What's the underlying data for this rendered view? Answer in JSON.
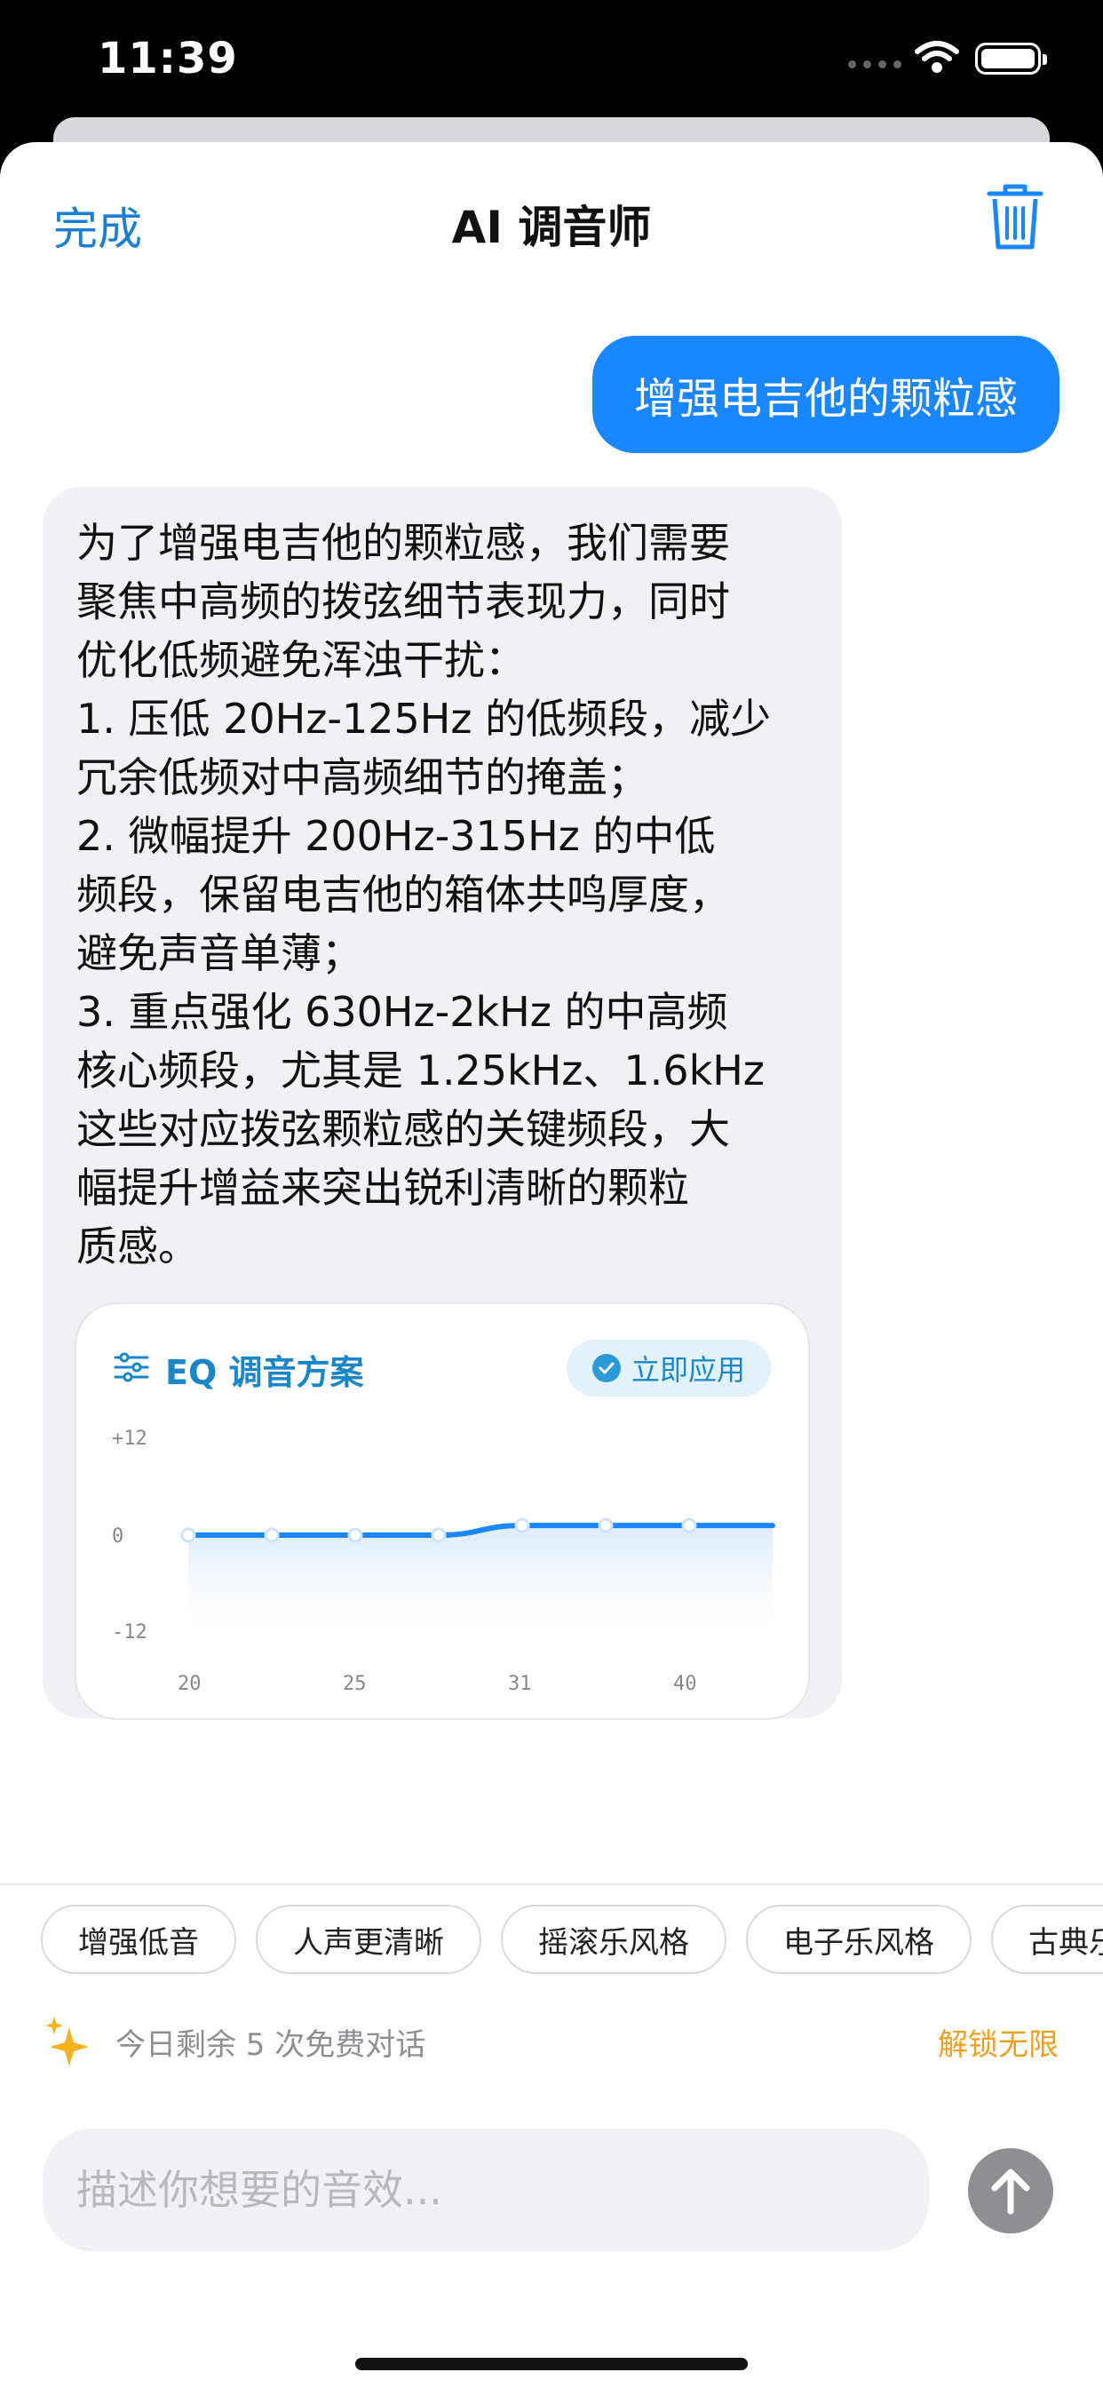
{
  "status_bar": {
    "time": "11:39"
  },
  "nav": {
    "done_label": "完成",
    "title": "AI 调音师",
    "trash_icon": "trash-icon"
  },
  "chat": {
    "user_message": "增强电吉他的颗粒感",
    "ai_message": "为了增强电吉他的颗粒感，我们需要\n聚焦中高频的拨弦细节表现力，同时\n优化低频避免浑浊干扰：\n1. 压低 20Hz-125Hz 的低频段，减少\n冗余低频对中高频细节的掩盖；\n2. 微幅提升 200Hz-315Hz 的中低\n频段，保留电吉他的箱体共鸣厚度，\n避免声音单薄；\n3. 重点强化 630Hz-2kHz 的中高频\n核心频段，尤其是 1.25kHz、1.6kHz\n这些对应拨弦颗粒感的关键频段，大\n幅提升增益来突出锐利清晰的颗粒\n质感。"
  },
  "eq_card": {
    "title": "EQ 调音方案",
    "apply_label": "立即应用",
    "accent_color": "#1a86c8"
  },
  "chart_data": {
    "type": "line",
    "y_tick_labels": [
      "+12",
      "0",
      "-12"
    ],
    "ylim": [
      -12,
      12
    ],
    "x_tick_labels": [
      "20",
      "25",
      "31",
      "40"
    ],
    "x_tick_positions": [
      0,
      2,
      4,
      6
    ],
    "series": [
      {
        "values": [
          0,
          0,
          0,
          0,
          1,
          1,
          1,
          1
        ]
      }
    ],
    "line_color": "#1a86ff"
  },
  "suggestions": [
    "增强低音",
    "人声更清晰",
    "摇滚乐风格",
    "电子乐风格",
    "古典乐风格"
  ],
  "quota": {
    "remaining_text": "今日剩余 5 次免费对话",
    "unlock_label": "解锁无限"
  },
  "composer": {
    "placeholder": "描述你想要的音效..."
  }
}
